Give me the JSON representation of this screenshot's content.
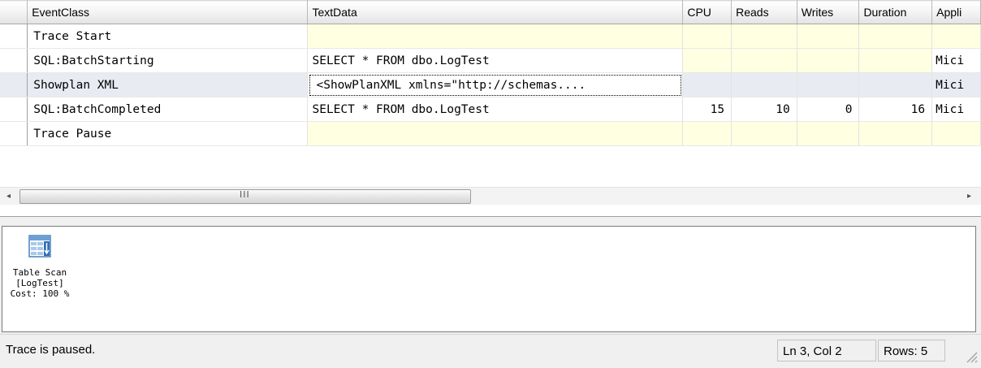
{
  "trace_grid": {
    "columns": [
      "EventClass",
      "TextData",
      "CPU",
      "Reads",
      "Writes",
      "Duration",
      "Appli"
    ],
    "rows": [
      {
        "event": "Trace Start",
        "text": "",
        "cpu": "",
        "reads": "",
        "writes": "",
        "duration": "",
        "app": ""
      },
      {
        "event": "SQL:BatchStarting",
        "text": "SELECT * FROM dbo.LogTest",
        "cpu": "",
        "reads": "",
        "writes": "",
        "duration": "",
        "app": "Mici"
      },
      {
        "event": "Showplan XML",
        "text": "<ShowPlanXML xmlns=\"http://schemas....",
        "cpu": "",
        "reads": "",
        "writes": "",
        "duration": "",
        "app": "Mici"
      },
      {
        "event": "SQL:BatchCompleted",
        "text": "SELECT * FROM dbo.LogTest",
        "cpu": "15",
        "reads": "10",
        "writes": "0",
        "duration": "16",
        "app": "Mici"
      },
      {
        "event": "Trace Pause",
        "text": "",
        "cpu": "",
        "reads": "",
        "writes": "",
        "duration": "",
        "app": ""
      }
    ],
    "selected_row": 3
  },
  "scrollbar": {
    "left_arrow": "◂",
    "right_arrow": "▸",
    "grip": "III",
    "thumb_fraction": 0.48
  },
  "plan_pane": {
    "operator": {
      "icon": "table-scan-icon",
      "name": "Table Scan",
      "object": "[LogTest]",
      "cost": "Cost: 100 %"
    }
  },
  "status_bar": {
    "message": "Trace is paused.",
    "position": "Ln 3, Col 2",
    "rows": "Rows: 5"
  },
  "colors": {
    "highlight_cell": "#ffffe1",
    "selected_row": "#e8ecf2",
    "grid_header": "#f2f2f2"
  }
}
